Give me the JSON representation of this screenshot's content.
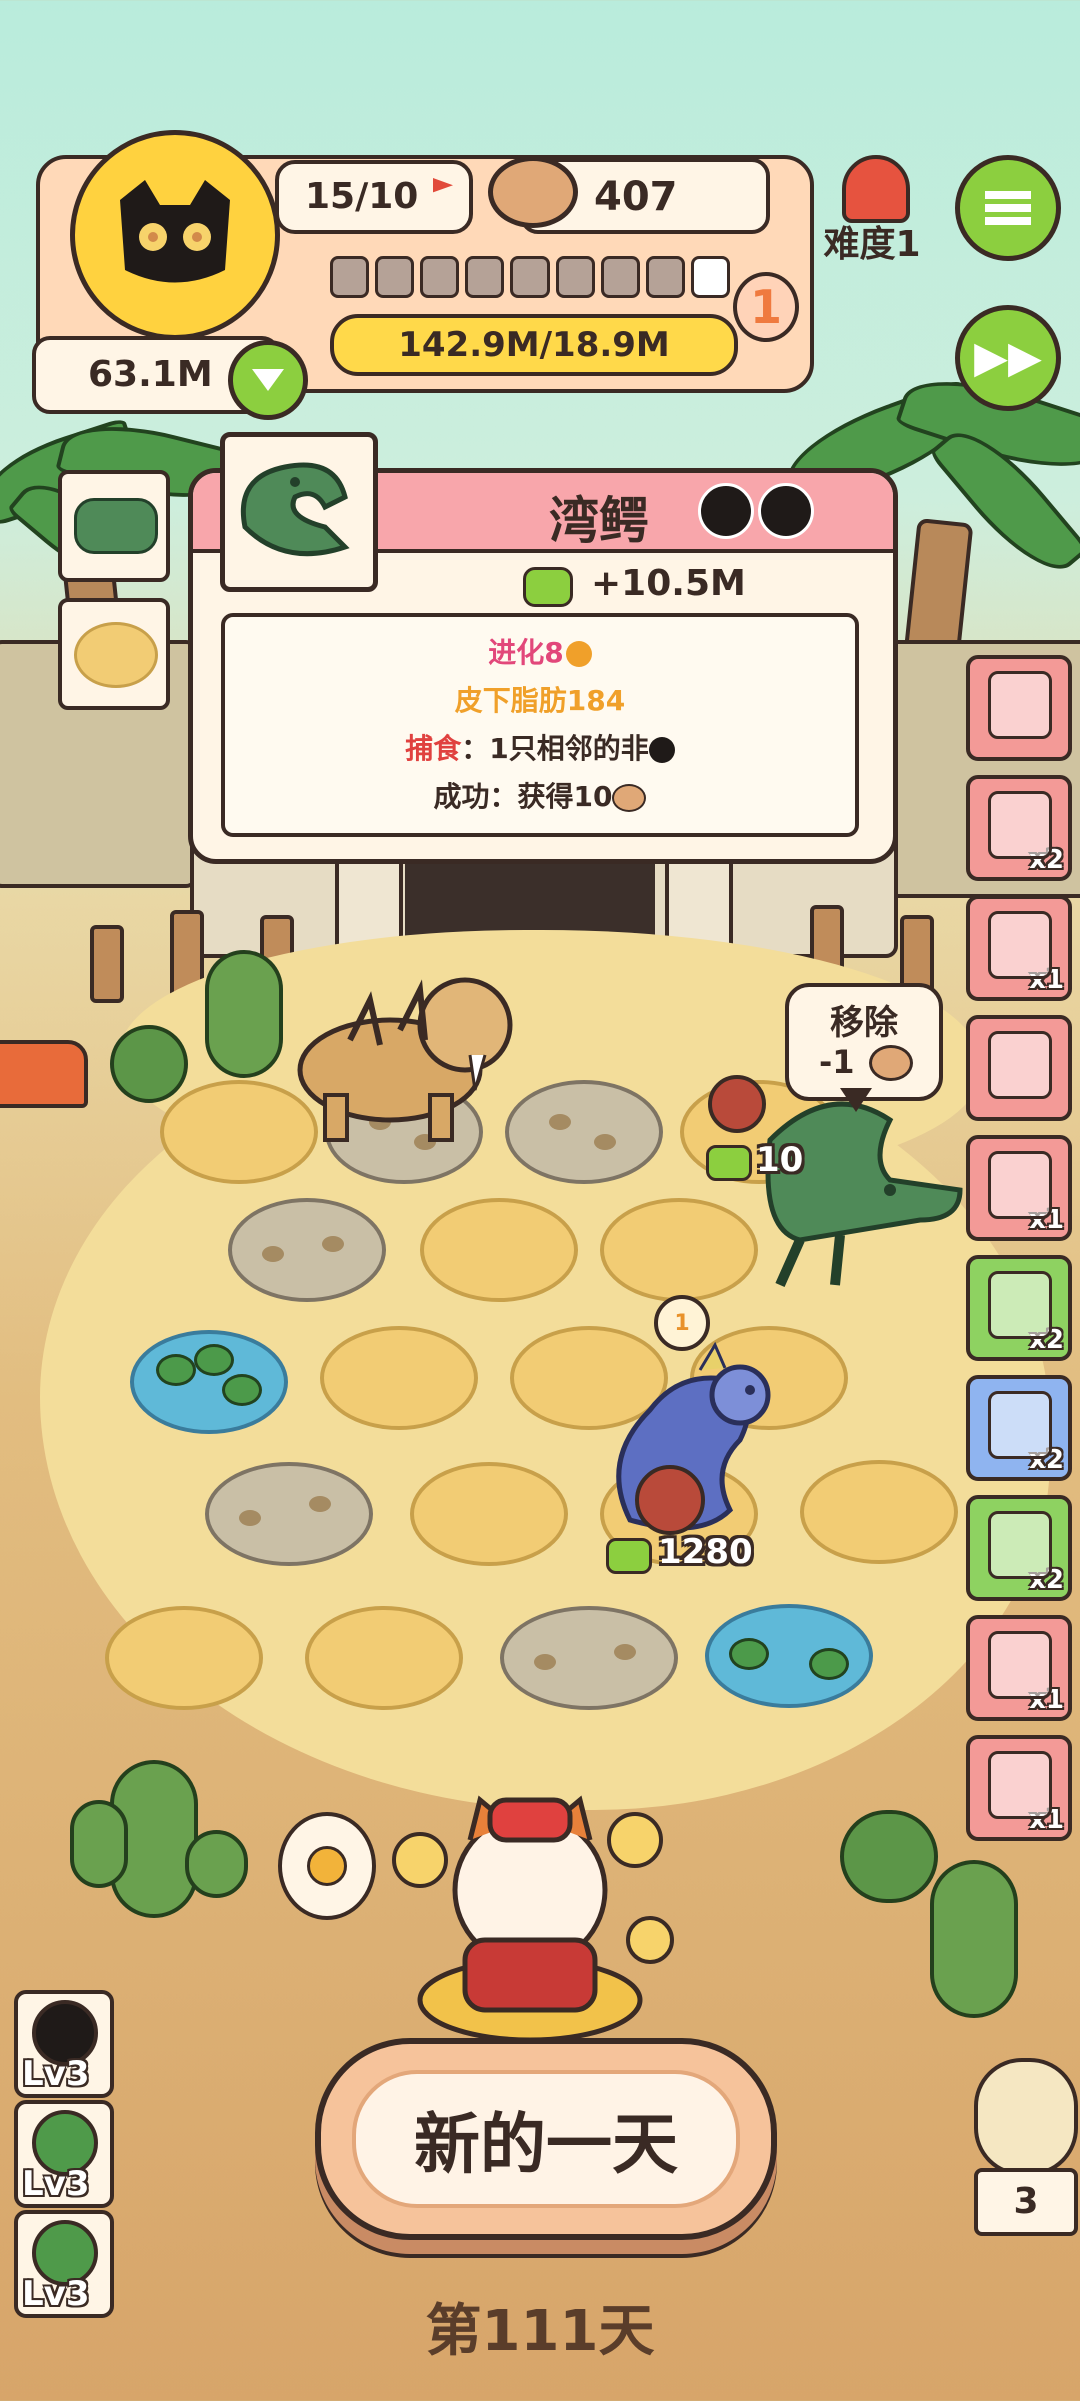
{
  "player": {
    "population": "15/10",
    "coins": "407",
    "reserve_value": "63.1M",
    "level_badge": "1",
    "progress_text": "142.9M/18.9M",
    "segments_total": 9,
    "segments_filled": 8
  },
  "difficulty": {
    "label": "难度1"
  },
  "popup": {
    "title": "湾鳄",
    "income": "+10.5M",
    "line_evolve": "进化8",
    "line_trait": "皮下脂肪184",
    "line_hunt_label": "捕食",
    "line_hunt_value": "：1只相邻的非",
    "line_success_label": "成功：",
    "line_success_value": "获得10",
    "colors": {
      "evolve": "#e2477a",
      "trait": "#f0a02a",
      "hunt": "#e0413f"
    }
  },
  "bubble": {
    "title": "移除",
    "cost": "-1"
  },
  "board": {
    "croc_value": "10",
    "dragon_value": "1280",
    "dragon_badge": "1"
  },
  "side_items": [
    {
      "icon": "scissors-icon",
      "count": "",
      "color": "red"
    },
    {
      "icon": "card-icon",
      "count": "x2",
      "color": "red"
    },
    {
      "icon": "jar-plant-icon",
      "count": "x1",
      "color": "red"
    },
    {
      "icon": "stand-icon",
      "count": "",
      "color": "red"
    },
    {
      "icon": "tray-icon",
      "count": "x1",
      "color": "red"
    },
    {
      "icon": "snack-bag-icon",
      "count": "x2",
      "color": "green"
    },
    {
      "icon": "bag-icon",
      "count": "x2",
      "color": "blue"
    },
    {
      "icon": "tent-icon",
      "count": "x2",
      "color": "green"
    },
    {
      "icon": "scroll-icon",
      "count": "x1",
      "color": "red"
    },
    {
      "icon": "crystal-icon",
      "count": "x1",
      "color": "red"
    }
  ],
  "skills": [
    {
      "level": "Lv3"
    },
    {
      "level": "Lv3"
    },
    {
      "level": "Lv3"
    }
  ],
  "new_day_button": "新的一天",
  "day_label": "第111天",
  "owl_counter": "3"
}
